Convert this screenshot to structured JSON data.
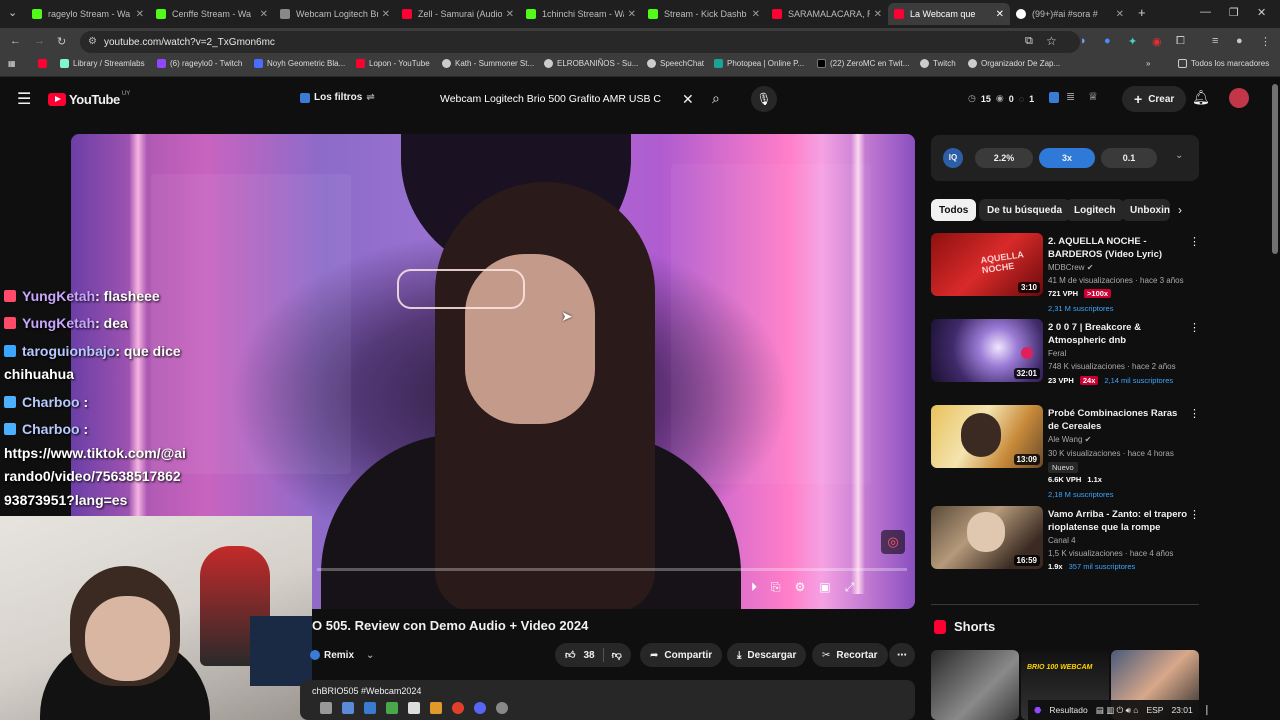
{
  "browser": {
    "tabs": [
      {
        "label": "rageylo Stream - Wa",
        "color": "#53fc18"
      },
      {
        "label": "Cenffe Stream - Wa",
        "color": "#53fc18"
      },
      {
        "label": "Webcam Logitech Br",
        "color": "#888888"
      },
      {
        "label": "Zell - Samurai (Audio",
        "color": "#ff0033"
      },
      {
        "label": "1chinchi Stream - Wa",
        "color": "#53fc18"
      },
      {
        "label": "Stream - Kick Dashb",
        "color": "#53fc18"
      },
      {
        "label": "SARAMALACARA, Ro",
        "color": "#ff0033"
      },
      {
        "label": "La Webcam que",
        "color": "#ff0033"
      },
      {
        "label": "(99+)#ai #sora #",
        "color": "#ffffff"
      }
    ],
    "new_tab": "+",
    "url": "youtube.com/watch?v=2_TxGmon6mc",
    "bookmarks": [
      "Library / Streamlabs",
      "(6) rageylo0 - Twitch",
      "Noyh Geometric Bla...",
      "Lopon - YouTube",
      "Kath - Summoner St...",
      "ELROBANIÑOS - Su...",
      "SpeechChat",
      "Photopea | Online P...",
      "(22) ZeroMC en Twit...",
      "Twitch",
      "Organizador De Zap..."
    ],
    "all_bookmarks": "Todos los marcadores"
  },
  "youtube": {
    "logo": "YouTube",
    "region": "UY",
    "filters_label": "Los filtros",
    "search_query": "Webcam Logitech Brio 500 Grafito AMR USB C",
    "counters": {
      "a": "15",
      "b": "0",
      "c": "1"
    },
    "create_label": "Crear"
  },
  "chat": [
    {
      "user": "YungKetah",
      "msg": ": flasheee"
    },
    {
      "user": "YungKetah",
      "msg": ": dea"
    },
    {
      "user": "taroguionbajo",
      "msg": ": que dice"
    },
    {
      "user": "",
      "msg": "chihuahua"
    },
    {
      "user": "Charboo",
      "msg": " :"
    },
    {
      "user": "Charboo",
      "msg": " :"
    },
    {
      "user": "",
      "msg": "https://www.tiktok.com/@ai"
    },
    {
      "user": "",
      "msg": "rando0/video/75638517862"
    },
    {
      "user": "",
      "msg": "93873951?lang=es"
    }
  ],
  "video": {
    "title": "O 505. Review con Demo Audio + Video 2024",
    "remix": "Remix",
    "likes": "38",
    "share": "Compartir",
    "download": "Descargar",
    "clip": "Recortar",
    "description": "chBRIO505 #Webcam2024"
  },
  "extension": {
    "pct": "2.2%",
    "speed": "3x",
    "val": "0.1"
  },
  "chips": [
    "Todos",
    "De tu búsqueda",
    "Logitech",
    "Unboxin"
  ],
  "recommendations": [
    {
      "title": "2. AQUELLA NOCHE - BARDEROS (Video Lyric)",
      "channel": "MDBCrew",
      "meta": "41 M de visualizaciones · hace 3 años",
      "duration": "3:10",
      "vph": "721 VPH",
      "mult": ">100x",
      "subs": "2,31 M suscriptores",
      "badge": ""
    },
    {
      "title": "2 0 0 7 | Breakcore & Atmospheric dnb",
      "channel": "Feral",
      "meta": "748 K visualizaciones · hace 2 años",
      "duration": "32:01",
      "vph": "23 VPH",
      "mult": "24x",
      "subs": "2,14 mil suscriptores",
      "badge": ""
    },
    {
      "title": "Probé Combinaciones Raras de Cereales",
      "channel": "Ale Wang",
      "meta": "30 K visualizaciones · hace 4 horas",
      "duration": "13:09",
      "vph": "6.6K VPH",
      "mult": "1.1x",
      "subs": "2,18 M suscriptores",
      "badge": "Nuevo"
    },
    {
      "title": "Vamo Arriba - Zanto: el trapero rioplatense que la rompe",
      "channel": "Canal 4",
      "meta": "1,5 K visualizaciones · hace 4 años",
      "duration": "16:59",
      "vph": "",
      "mult": "1.9x",
      "subs": "357 mil suscriptores",
      "badge": ""
    }
  ],
  "shorts": {
    "heading": "Shorts",
    "thumb2": "BRIO 100 WEBCAM"
  },
  "tray": {
    "result": "Resultado",
    "lang": "ESP",
    "time": "23:01"
  },
  "colors": {
    "accent": "#3ea6ff",
    "brand": "#ff0033",
    "bg": "#0f0f0f"
  }
}
